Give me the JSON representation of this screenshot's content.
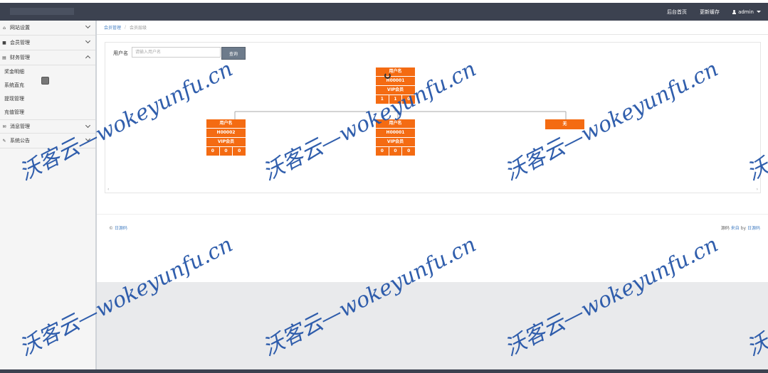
{
  "topbar": {
    "nav": [
      "后台首页",
      "更新缓存"
    ],
    "user": "admin"
  },
  "sidebar": {
    "items": [
      {
        "label": "网站设置",
        "icon": "home-icon",
        "expanded": false
      },
      {
        "label": "会员管理",
        "icon": "user-icon",
        "expanded": false
      },
      {
        "label": "财务管理",
        "icon": "list-icon",
        "expanded": true,
        "children": [
          "奖金明细",
          "系统直充",
          "提现管理",
          "充值管理"
        ]
      },
      {
        "label": "消息管理",
        "icon": "envelope-icon",
        "expanded": false
      },
      {
        "label": "系统公告",
        "icon": "edit-icon",
        "expanded": false
      }
    ]
  },
  "breadcrumb": {
    "parent": "会员管理",
    "current": "会员层级"
  },
  "search": {
    "label": "用户名",
    "placeholder": "请输入用户名",
    "button": "查询"
  },
  "tree": {
    "root": {
      "name_label": "用户名",
      "id": "H00001",
      "level": "VIP会员",
      "counts": [
        "1",
        "1",
        "0"
      ]
    },
    "children": [
      {
        "name_label": "用户名",
        "id": "H00002",
        "level": "VIP会员",
        "counts": [
          "0",
          "0",
          "0"
        ]
      },
      {
        "name_label": "用户名",
        "id": "H00001",
        "level": "VIP会员",
        "counts": [
          "0",
          "0",
          "0"
        ]
      },
      {
        "empty_label": "无"
      }
    ]
  },
  "scroll": {
    "left": "‹",
    "right": "›"
  },
  "footer": {
    "copyright": "© ",
    "site": "日源码",
    "right_prefix": "源码 ",
    "right_link1": "来自",
    "right_mid": " by ",
    "right_link2": "日源码"
  },
  "watermark": "沃客云—wokeyunfu.cn",
  "colors": {
    "accent": "#f46b12",
    "topbar": "#3c4250",
    "link": "#4b83c5"
  }
}
